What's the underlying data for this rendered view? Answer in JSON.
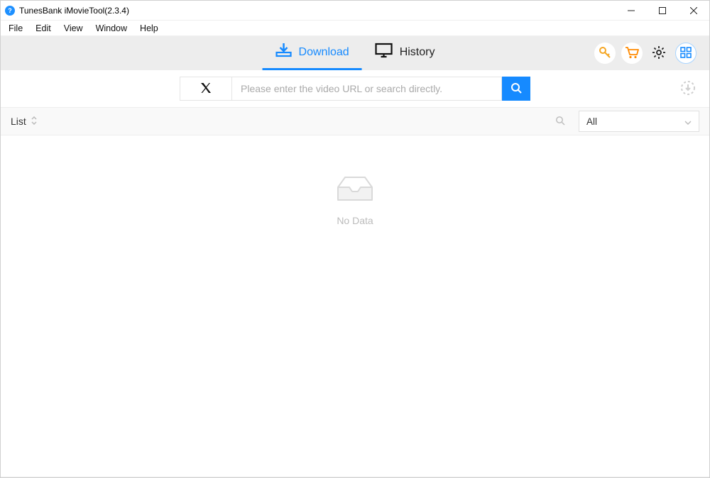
{
  "titlebar": {
    "title": "TunesBank iMovieTool(2.3.4)"
  },
  "menubar": {
    "items": [
      "File",
      "Edit",
      "View",
      "Window",
      "Help"
    ]
  },
  "tabs": {
    "download": "Download",
    "history": "History",
    "active": "download"
  },
  "search": {
    "placeholder": "Please enter the video URL or search directly."
  },
  "list": {
    "label": "List",
    "filter_value": "All",
    "empty_text": "No Data"
  },
  "icons": {
    "key": "key-icon",
    "cart": "cart-icon",
    "gear": "gear-icon",
    "grid": "grid-icon"
  },
  "colors": {
    "accent": "#168aff",
    "gold": "#f5a623",
    "orange": "#ff8a00"
  }
}
